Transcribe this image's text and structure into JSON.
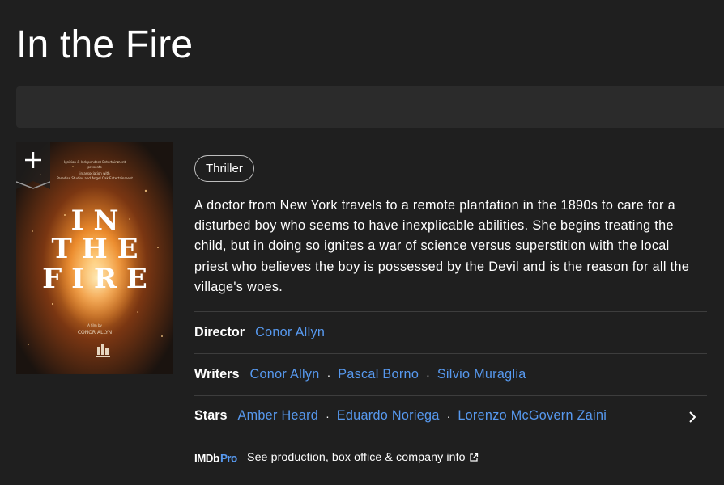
{
  "title": "In the Fire",
  "poster": {
    "title_lines": [
      "I N",
      "T H E",
      "F I R E"
    ],
    "top_credits": [
      "Ignition & Independent Entertainment",
      "presents",
      "in association with",
      "Paradise Studios and Angel Oak Entertainment"
    ],
    "a_film_by": "A film by",
    "director": "CONOR ALLYN"
  },
  "watchlist": {
    "icon": "plus-icon"
  },
  "genres": [
    "Thriller"
  ],
  "plot": "A doctor from New York travels to a remote plantation in the 1890s to care for a disturbed boy who seems to have inexplicable abilities. She begins treating the child, but in doing so ignites a war of science versus superstition with the local priest who believes the boy is possessed by the Devil and is the reason for all the village's woes.",
  "credits": {
    "director": {
      "label": "Director",
      "names": [
        "Conor Allyn"
      ]
    },
    "writers": {
      "label": "Writers",
      "names": [
        "Conor Allyn",
        "Pascal Borno",
        "Silvio Muraglia"
      ]
    },
    "stars": {
      "label": "Stars",
      "names": [
        "Amber Heard",
        "Eduardo Noriega",
        "Lorenzo McGovern Zaini"
      ]
    }
  },
  "imdbpro": {
    "logo_text": "IMDbPro",
    "link_text": "See production, box office & company info"
  },
  "colors": {
    "background": "#1f1f1f",
    "link": "#5799ef",
    "pro_blue": "#5799ef",
    "divider": "#3d3d3d"
  }
}
